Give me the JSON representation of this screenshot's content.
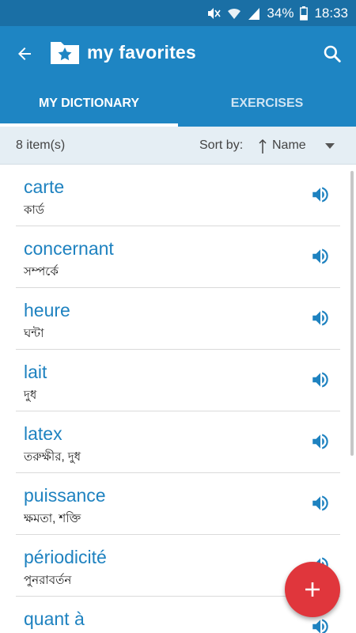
{
  "status_bar": {
    "battery": "34%",
    "time": "18:33",
    "icons": [
      "mute-icon",
      "wifi-icon",
      "signal-icon",
      "battery-icon"
    ]
  },
  "app_bar": {
    "title": "my favorites",
    "icons": [
      "back-arrow-icon",
      "star-folder-icon",
      "search-icon"
    ],
    "background": "#1e85c3"
  },
  "tabs": [
    {
      "label": "MY DICTIONARY",
      "active": true
    },
    {
      "label": "EXERCISES",
      "active": false
    }
  ],
  "sort_bar": {
    "count": "8 item(s)",
    "sort_label": "Sort by:",
    "sort_value": "Name"
  },
  "items": [
    {
      "word": "carte",
      "meaning": "কার্ড"
    },
    {
      "word": "concernant",
      "meaning": "সম্পর্কে"
    },
    {
      "word": "heure",
      "meaning": "ঘন্টা"
    },
    {
      "word": "lait",
      "meaning": "দুধ"
    },
    {
      "word": "latex",
      "meaning": "তরুক্ষীর, দুধ"
    },
    {
      "word": "puissance",
      "meaning": "ক্ষমতা, শক্তি"
    },
    {
      "word": "périodicité",
      "meaning": "পুনরাবর্তন"
    },
    {
      "word": "quant à",
      "meaning": ""
    }
  ],
  "fab": {
    "icon": "plus-icon",
    "color": "#e0363c"
  }
}
